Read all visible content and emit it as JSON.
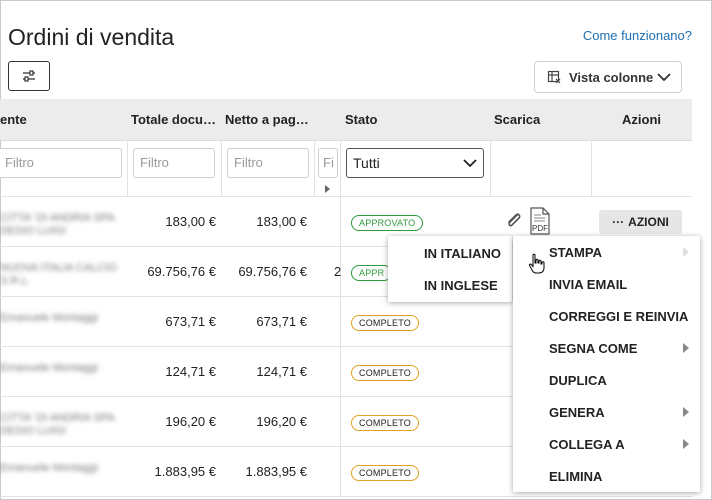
{
  "header": {
    "title": "Ordini di vendita",
    "help_link": "Come funzionano?"
  },
  "toolbar": {
    "filter_icon": "sliders-icon",
    "columns_label": "Vista colonne"
  },
  "table": {
    "headers": [
      "ente",
      "Totale docu…",
      "Netto a pag…",
      "Stato",
      "Scarica",
      "Azioni"
    ],
    "filter_placeholder": "Filtro",
    "partial_filter_placeholder": "Fi",
    "stato_filter_value": "Tutti",
    "rows": [
      {
        "client": "CITTA' DI ANDRIA SPA",
        "client2": "DESIO LUIGI",
        "totale": "183,00 €",
        "netto": "183,00 €",
        "extra": "",
        "stato": "APPROVATO",
        "stato_kind": "ok"
      },
      {
        "client": "NUOVA ITALIA CALCIO",
        "client2": "S.R.L.",
        "totale": "69.756,76 €",
        "netto": "69.756,76 €",
        "extra": "2",
        "stato": "APPR",
        "stato_kind": "ok"
      },
      {
        "client": "Emanuele Montaggi",
        "client2": "",
        "totale": "673,71 €",
        "netto": "673,71 €",
        "extra": "",
        "stato": "COMPLETO",
        "stato_kind": "done"
      },
      {
        "client": "Emanuele Montaggi",
        "client2": "",
        "totale": "124,71 €",
        "netto": "124,71 €",
        "extra": "",
        "stato": "COMPLETO",
        "stato_kind": "done"
      },
      {
        "client": "CITTA' DI ANDRIA SPA",
        "client2": "DESIO LUIGI",
        "totale": "196,20 €",
        "netto": "196,20 €",
        "extra": "",
        "stato": "COMPLETO",
        "stato_kind": "done"
      },
      {
        "client": "Emanuele Montaggi",
        "client2": "",
        "totale": "1.883,95 €",
        "netto": "1.883,95 €",
        "extra": "",
        "stato": "COMPLETO",
        "stato_kind": "done"
      }
    ],
    "actions_label": "AZIONI",
    "pdf_label": "PDF"
  },
  "menu": {
    "items": [
      {
        "label": "STAMPA",
        "has_sub": true,
        "active": true
      },
      {
        "label": "INVIA EMAIL",
        "has_sub": false
      },
      {
        "label": "CORREGGI E REINVIA",
        "has_sub": false
      },
      {
        "label": "SEGNA COME",
        "has_sub": true
      },
      {
        "label": "DUPLICA",
        "has_sub": false
      },
      {
        "label": "GENERA",
        "has_sub": true
      },
      {
        "label": "COLLEGA A",
        "has_sub": true
      },
      {
        "label": "ELIMINA",
        "has_sub": false
      }
    ],
    "submenu": [
      "IN ITALIANO",
      "IN INGLESE"
    ]
  },
  "colors": {
    "link": "#1f6fb2",
    "approved": "#2e9a3a",
    "completed": "#e0a020",
    "header_bg": "#ececec"
  }
}
